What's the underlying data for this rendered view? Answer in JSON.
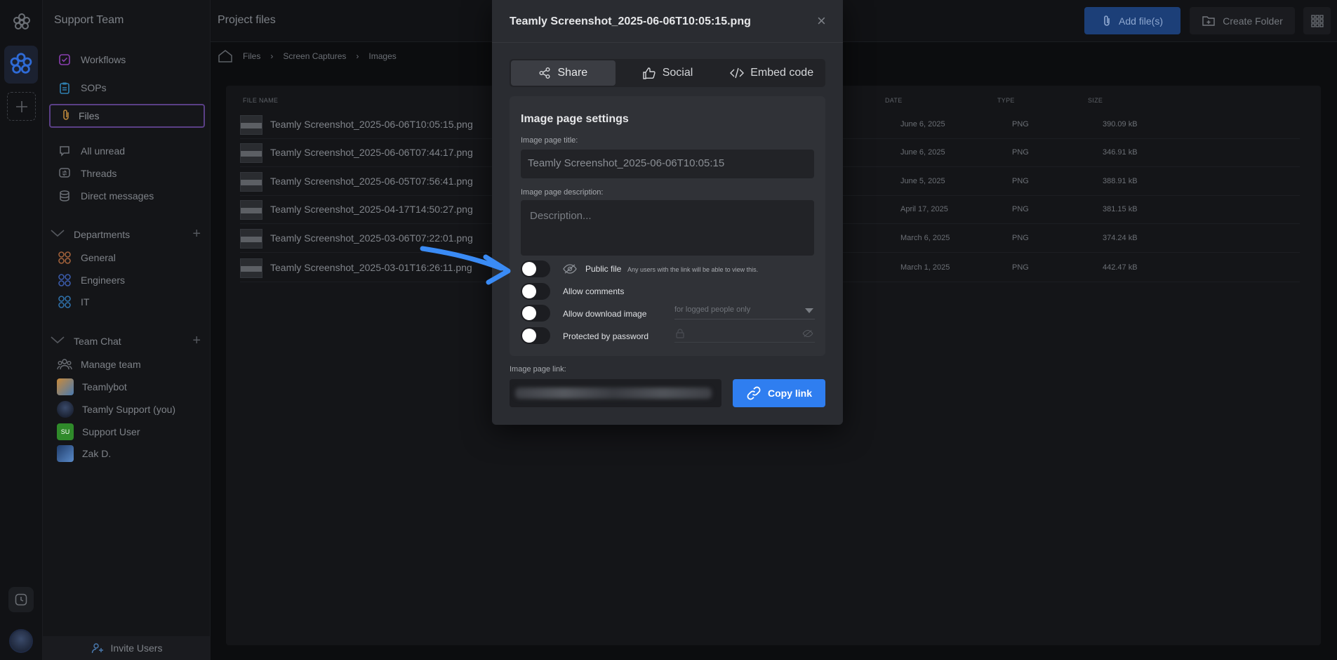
{
  "workspace": {
    "name": "Support Team"
  },
  "nav": {
    "top_items": [
      {
        "label": "Workflows",
        "icon": "workflow-check-icon"
      },
      {
        "label": "SOPs",
        "icon": "clipboard-icon"
      },
      {
        "label": "Files",
        "icon": "paperclip-icon"
      }
    ],
    "inbox_items": [
      {
        "label": "All unread",
        "icon": "chat-bubble-icon"
      },
      {
        "label": "Threads",
        "icon": "threads-icon"
      },
      {
        "label": "Direct messages",
        "icon": "database-icon"
      }
    ],
    "departments": {
      "title": "Departments",
      "items": [
        {
          "label": "General"
        },
        {
          "label": "Engineers"
        },
        {
          "label": "IT"
        }
      ]
    },
    "team_chat": {
      "title": "Team Chat",
      "items": [
        {
          "label": "Manage team"
        },
        {
          "label": "Teamlybot"
        },
        {
          "label": "Teamly Support (you)"
        },
        {
          "label": "Support User",
          "initials": "SU"
        },
        {
          "label": "Zak D."
        }
      ]
    },
    "invite_label": "Invite Users"
  },
  "header": {
    "title": "Project files",
    "add_label": "Add file(s)",
    "create_folder_label": "Create Folder"
  },
  "breadcrumb": [
    "Files",
    "Screen Captures",
    "Images"
  ],
  "table": {
    "columns": {
      "name": "FILE NAME",
      "date": "DATE",
      "type": "TYPE",
      "size": "SIZE"
    },
    "rows": [
      {
        "name": "Teamly Screenshot_2025-06-06T10:05:15.png",
        "date": "June 6, 2025",
        "type": "PNG",
        "size": "390.09 kB"
      },
      {
        "name": "Teamly Screenshot_2025-06-06T07:44:17.png",
        "date": "June 6, 2025",
        "type": "PNG",
        "size": "346.91 kB"
      },
      {
        "name": "Teamly Screenshot_2025-06-05T07:56:41.png",
        "date": "June 5, 2025",
        "type": "PNG",
        "size": "388.91 kB"
      },
      {
        "name": "Teamly Screenshot_2025-04-17T14:50:27.png",
        "date": "April 17, 2025",
        "type": "PNG",
        "size": "381.15 kB"
      },
      {
        "name": "Teamly Screenshot_2025-03-06T07:22:01.png",
        "date": "March 6, 2025",
        "type": "PNG",
        "size": "374.24 kB"
      },
      {
        "name": "Teamly Screenshot_2025-03-01T16:26:11.png",
        "date": "March 1, 2025",
        "type": "PNG",
        "size": "442.47 kB"
      }
    ]
  },
  "modal": {
    "title": "Teamly Screenshot_2025-06-06T10:05:15.png",
    "tabs": [
      {
        "label": "Share",
        "active": true
      },
      {
        "label": "Social",
        "active": false
      },
      {
        "label": "Embed code",
        "active": false
      }
    ],
    "settings": {
      "heading": "Image page settings",
      "title_label": "Image page title:",
      "title_value": "Teamly Screenshot_2025-06-06T10:05:15",
      "description_label": "Image page description:",
      "description_placeholder": "Description...",
      "public_file": {
        "label": "Public file",
        "note": "Any users with the link will be able to view this.",
        "enabled": false
      },
      "allow_comments": {
        "label": "Allow comments",
        "enabled": false
      },
      "allow_download": {
        "label": "Allow download image",
        "option": "for logged people only",
        "enabled": false
      },
      "password": {
        "label": "Protected by password",
        "enabled": false
      }
    },
    "link_label": "Image page link:",
    "copy_label": "Copy link"
  },
  "colors": {
    "accent": "#2f7ef0",
    "arrow": "#3a8bf5",
    "files_highlight": "#5a3f86"
  }
}
